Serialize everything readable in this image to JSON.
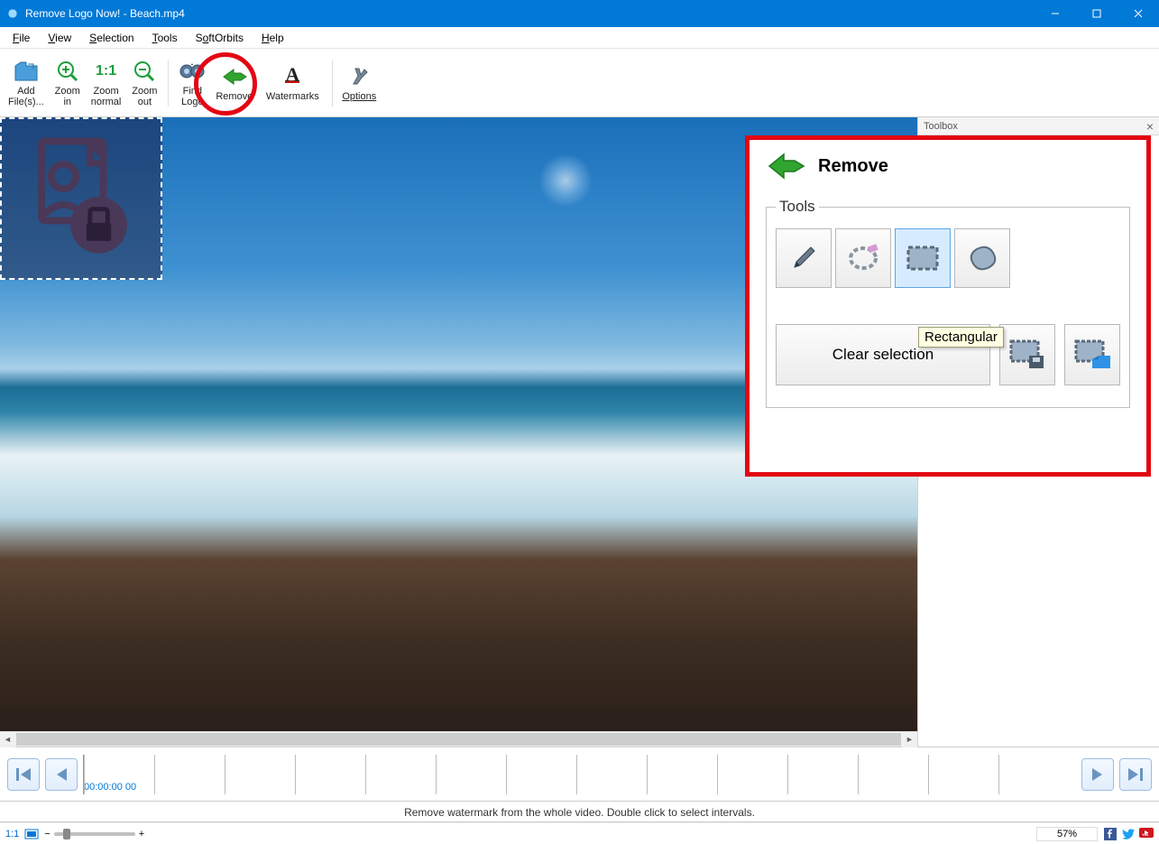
{
  "window": {
    "title": "Remove Logo Now! - Beach.mp4"
  },
  "menu": {
    "file": "File",
    "view": "View",
    "selection": "Selection",
    "tools": "Tools",
    "softorbits": "SoftOrbits",
    "help": "Help"
  },
  "toolbar": {
    "add_files": "Add\nFile(s)...",
    "zoom_in": "Zoom\nin",
    "zoom_normal": "Zoom\nnormal",
    "zoom_out": "Zoom\nout",
    "find_logo": "Find\nLogo",
    "remove": "Remove",
    "watermarks": "Watermarks",
    "options": "Options"
  },
  "toolbox": {
    "panel_title": "Toolbox",
    "remove_title": "Remove",
    "tools_group": "Tools",
    "tooltip": "Rectangular",
    "clear_selection": "Clear selection"
  },
  "timeline": {
    "timecode": "00:00:00 00"
  },
  "hint": "Remove watermark from the whole video. Double click to select intervals.",
  "status": {
    "ratio": "1:1",
    "zoom_pct": "57%"
  }
}
